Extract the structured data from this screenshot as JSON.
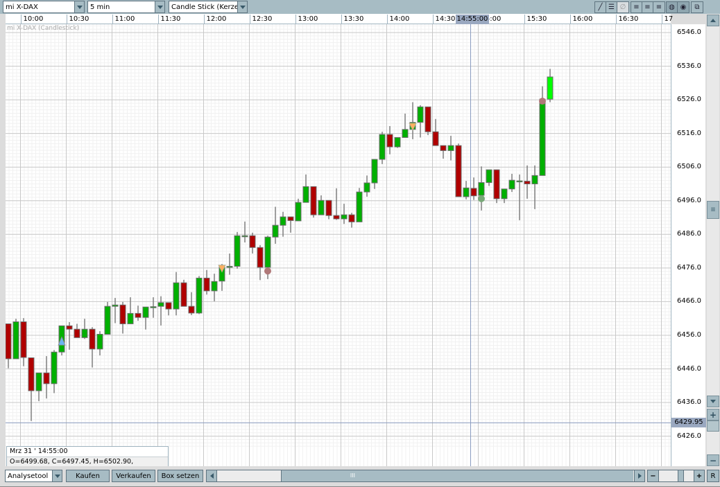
{
  "toolbar": {
    "instrument": "mi X-DAX",
    "interval": "5 min",
    "chart_type": "Candle Stick (Kerze",
    "icons": [
      "line-draw-icon",
      "horizontal-lines-icon",
      "delete-drawing-icon",
      "grid-lines-icon",
      "grid-dashed-icon",
      "grid-dotted-icon",
      "color-scheme-icon",
      "pattern-icon",
      "detach-window-icon"
    ]
  },
  "chart_title": "mi X-DAX (Candlestick)",
  "time_axis": {
    "labels": [
      "10:00",
      "10:30",
      "11:00",
      "11:30",
      "12:00",
      "12:30",
      "13:00",
      "13:30",
      "14:00",
      "14:30",
      "15:00",
      "15:30",
      "16:00",
      "16:30",
      "17"
    ],
    "cursor_label": "14:55:00"
  },
  "price_axis": {
    "labels": [
      "6546.0",
      "6536.0",
      "6526.0",
      "6516.0",
      "6506.0",
      "6496.0",
      "6486.0",
      "6476.0",
      "6466.0",
      "6456.0",
      "6446.0",
      "6436.0",
      "6426.0"
    ],
    "cursor_label": "6429.95"
  },
  "info": {
    "date": "Mrz 31 ' 14:55:00",
    "ohlc": "O=6499.68, C=6497.45, H=6502.90, L=6496.22"
  },
  "bottom": {
    "tool_select": "Analysetool",
    "buy": "Kaufen",
    "sell": "Verkaufen",
    "box": "Box setzen",
    "reset": "R",
    "scroll_grip": "III"
  },
  "colors": {
    "up": "#00b000",
    "down": "#b00000",
    "last_up": "#00ff00",
    "outline": "#6e6e6e",
    "crosshair": "#8a9cc0",
    "toolbar": "#a7bcc4"
  },
  "chart_data": {
    "type": "candlestick",
    "interval": "5 min",
    "ylim": [
      6423,
      6550
    ],
    "xlim": [
      "09:45",
      "17:05"
    ],
    "grid": true,
    "crosshair": {
      "time": "14:55",
      "price": 6429.95
    },
    "candles": [
      {
        "t": "09:50",
        "o": 6459.4,
        "h": 6459.4,
        "l": 6446.2,
        "c": 6449.0
      },
      {
        "t": "09:55",
        "o": 6449.0,
        "h": 6460.9,
        "l": 6449.0,
        "c": 6460.0
      },
      {
        "t": "10:00",
        "o": 6460.0,
        "h": 6461.1,
        "l": 6446.8,
        "c": 6449.4
      },
      {
        "t": "10:05",
        "o": 6449.3,
        "h": 6449.3,
        "l": 6430.5,
        "c": 6439.5
      },
      {
        "t": "10:10",
        "o": 6439.5,
        "h": 6444.8,
        "l": 6436.4,
        "c": 6444.8
      },
      {
        "t": "10:15",
        "o": 6444.8,
        "h": 6449.8,
        "l": 6437.2,
        "c": 6441.6
      },
      {
        "t": "10:20",
        "o": 6441.6,
        "h": 6451.6,
        "l": 6438.8,
        "c": 6451.0
      },
      {
        "t": "10:25",
        "o": 6451.0,
        "h": 6458.8,
        "l": 6450.0,
        "c": 6458.8
      },
      {
        "t": "10:30",
        "o": 6458.8,
        "h": 6459.9,
        "l": 6451.7,
        "c": 6457.8
      },
      {
        "t": "10:35",
        "o": 6457.8,
        "h": 6459.4,
        "l": 6455.3,
        "c": 6455.3
      },
      {
        "t": "10:40",
        "o": 6455.3,
        "h": 6460.9,
        "l": 6454.9,
        "c": 6457.8
      },
      {
        "t": "10:45",
        "o": 6457.8,
        "h": 6458.4,
        "l": 6446.4,
        "c": 6451.9
      },
      {
        "t": "10:50",
        "o": 6451.9,
        "h": 6457.2,
        "l": 6450.0,
        "c": 6456.3
      },
      {
        "t": "10:55",
        "o": 6456.3,
        "h": 6465.9,
        "l": 6456.3,
        "c": 6464.6
      },
      {
        "t": "11:00",
        "o": 6464.6,
        "h": 6467.1,
        "l": 6459.6,
        "c": 6465.0
      },
      {
        "t": "11:05",
        "o": 6465.0,
        "h": 6465.9,
        "l": 6456.5,
        "c": 6459.4
      },
      {
        "t": "11:10",
        "o": 6459.4,
        "h": 6467.3,
        "l": 6459.4,
        "c": 6462.5
      },
      {
        "t": "11:15",
        "o": 6462.5,
        "h": 6464.8,
        "l": 6460.3,
        "c": 6461.3
      },
      {
        "t": "11:20",
        "o": 6461.3,
        "h": 6464.4,
        "l": 6457.7,
        "c": 6464.4
      },
      {
        "t": "11:25",
        "o": 6464.5,
        "h": 6467.3,
        "l": 6461.2,
        "c": 6464.5
      },
      {
        "t": "11:30",
        "o": 6464.6,
        "h": 6467.6,
        "l": 6458.9,
        "c": 6465.7
      },
      {
        "t": "11:35",
        "o": 6465.7,
        "h": 6465.7,
        "l": 6461.9,
        "c": 6463.8
      },
      {
        "t": "11:40",
        "o": 6463.8,
        "h": 6474.8,
        "l": 6461.9,
        "c": 6471.6
      },
      {
        "t": "11:45",
        "o": 6471.6,
        "h": 6472.5,
        "l": 6464.6,
        "c": 6464.6
      },
      {
        "t": "11:50",
        "o": 6464.6,
        "h": 6468.8,
        "l": 6462.0,
        "c": 6462.6
      },
      {
        "t": "11:55",
        "o": 6462.6,
        "h": 6473.6,
        "l": 6462.3,
        "c": 6473.0
      },
      {
        "t": "12:00",
        "o": 6473.0,
        "h": 6475.4,
        "l": 6468.1,
        "c": 6469.2
      },
      {
        "t": "12:05",
        "o": 6469.2,
        "h": 6474.3,
        "l": 6466.1,
        "c": 6472.0
      },
      {
        "t": "12:10",
        "o": 6472.1,
        "h": 6477.2,
        "l": 6469.2,
        "c": 6476.5
      },
      {
        "t": "12:15",
        "o": 6476.5,
        "h": 6480.3,
        "l": 6474.0,
        "c": 6476.5
      },
      {
        "t": "12:20",
        "o": 6476.5,
        "h": 6486.7,
        "l": 6475.8,
        "c": 6485.6
      },
      {
        "t": "12:25",
        "o": 6485.6,
        "h": 6489.8,
        "l": 6483.6,
        "c": 6485.6
      },
      {
        "t": "12:30",
        "o": 6485.6,
        "h": 6486.5,
        "l": 6480.3,
        "c": 6482.1
      },
      {
        "t": "12:35",
        "o": 6482.1,
        "h": 6482.8,
        "l": 6472.4,
        "c": 6476.2
      },
      {
        "t": "12:40",
        "o": 6476.2,
        "h": 6485.6,
        "l": 6472.7,
        "c": 6485.2
      },
      {
        "t": "12:45",
        "o": 6485.2,
        "h": 6494.2,
        "l": 6483.2,
        "c": 6488.7
      },
      {
        "t": "12:50",
        "o": 6488.7,
        "h": 6492.7,
        "l": 6485.3,
        "c": 6491.2
      },
      {
        "t": "12:55",
        "o": 6491.2,
        "h": 6491.2,
        "l": 6486.5,
        "c": 6490.1
      },
      {
        "t": "13:00",
        "o": 6490.0,
        "h": 6496.6,
        "l": 6490.0,
        "c": 6495.5
      },
      {
        "t": "13:05",
        "o": 6495.5,
        "h": 6503.8,
        "l": 6495.5,
        "c": 6500.2
      },
      {
        "t": "13:10",
        "o": 6500.2,
        "h": 6500.2,
        "l": 6491.0,
        "c": 6491.8
      },
      {
        "t": "13:15",
        "o": 6491.8,
        "h": 6497.6,
        "l": 6491.8,
        "c": 6496.1
      },
      {
        "t": "13:20",
        "o": 6496.1,
        "h": 6496.1,
        "l": 6490.5,
        "c": 6491.6
      },
      {
        "t": "13:25",
        "o": 6491.6,
        "h": 6499.7,
        "l": 6490.3,
        "c": 6490.6
      },
      {
        "t": "13:30",
        "o": 6490.6,
        "h": 6495.1,
        "l": 6489.1,
        "c": 6491.8
      },
      {
        "t": "13:35",
        "o": 6491.8,
        "h": 6492.4,
        "l": 6488.0,
        "c": 6489.7
      },
      {
        "t": "13:40",
        "o": 6489.7,
        "h": 6499.8,
        "l": 6489.7,
        "c": 6498.6
      },
      {
        "t": "13:45",
        "o": 6498.6,
        "h": 6503.5,
        "l": 6497.2,
        "c": 6501.3
      },
      {
        "t": "13:50",
        "o": 6501.3,
        "h": 6508.3,
        "l": 6499.5,
        "c": 6508.3
      },
      {
        "t": "13:55",
        "o": 6508.3,
        "h": 6516.5,
        "l": 6506.9,
        "c": 6515.7
      },
      {
        "t": "14:00",
        "o": 6515.7,
        "h": 6518.2,
        "l": 6509.8,
        "c": 6512.0
      },
      {
        "t": "14:05",
        "o": 6512.0,
        "h": 6514.8,
        "l": 6511.7,
        "c": 6514.8
      },
      {
        "t": "14:10",
        "o": 6514.8,
        "h": 6521.9,
        "l": 6514.8,
        "c": 6517.2
      },
      {
        "t": "14:15",
        "o": 6517.2,
        "h": 6525.3,
        "l": 6514.3,
        "c": 6519.3
      },
      {
        "t": "14:20",
        "o": 6519.3,
        "h": 6524.4,
        "l": 6514.8,
        "c": 6523.9
      },
      {
        "t": "14:25",
        "o": 6523.9,
        "h": 6523.9,
        "l": 6515.5,
        "c": 6516.5
      },
      {
        "t": "14:30",
        "o": 6516.5,
        "h": 6520.3,
        "l": 6512.4,
        "c": 6512.4
      },
      {
        "t": "14:35",
        "o": 6512.4,
        "h": 6512.4,
        "l": 6508.5,
        "c": 6510.9
      },
      {
        "t": "14:40",
        "o": 6510.9,
        "h": 6515.3,
        "l": 6508.0,
        "c": 6512.4
      },
      {
        "t": "14:45",
        "o": 6512.4,
        "h": 6513.0,
        "l": 6497.2,
        "c": 6497.2
      },
      {
        "t": "14:50",
        "o": 6497.2,
        "h": 6501.9,
        "l": 6496.4,
        "c": 6499.8
      },
      {
        "t": "14:55",
        "o": 6499.68,
        "h": 6502.9,
        "l": 6496.22,
        "c": 6497.45
      },
      {
        "t": "15:00",
        "o": 6497.6,
        "h": 6506.2,
        "l": 6493.1,
        "c": 6501.4
      },
      {
        "t": "15:05",
        "o": 6501.4,
        "h": 6505.2,
        "l": 6500.4,
        "c": 6505.2
      },
      {
        "t": "15:10",
        "o": 6505.2,
        "h": 6505.2,
        "l": 6495.3,
        "c": 6496.6
      },
      {
        "t": "15:15",
        "o": 6496.6,
        "h": 6499.5,
        "l": 6495.3,
        "c": 6499.5
      },
      {
        "t": "15:20",
        "o": 6499.5,
        "h": 6504.0,
        "l": 6498.6,
        "c": 6502.1
      },
      {
        "t": "15:25",
        "o": 6501.9,
        "h": 6503.8,
        "l": 6490.2,
        "c": 6501.9
      },
      {
        "t": "15:30",
        "o": 6501.8,
        "h": 6506.5,
        "l": 6496.6,
        "c": 6501.0
      },
      {
        "t": "15:35",
        "o": 6501.0,
        "h": 6506.5,
        "l": 6493.5,
        "c": 6503.5
      },
      {
        "t": "15:40",
        "o": 6503.5,
        "h": 6530.0,
        "l": 6503.5,
        "c": 6526.2
      },
      {
        "t": "15:45",
        "o": 6526.2,
        "h": 6535.2,
        "l": 6525.3,
        "c": 6532.8
      }
    ],
    "markers": [
      {
        "t": "10:25",
        "price": 6454.1,
        "shape": "triangle-up",
        "color": "#6ab4f0"
      },
      {
        "t": "12:10",
        "price": 6475.8,
        "shape": "triangle-down",
        "color": "#ffb060"
      },
      {
        "t": "12:40",
        "price": 6475.1,
        "shape": "circle",
        "color": "#b07878"
      },
      {
        "t": "14:15",
        "price": 6518.0,
        "shape": "triangle-down",
        "color": "#ffb060"
      },
      {
        "t": "15:00",
        "price": 6496.6,
        "shape": "circle",
        "color": "#78a878"
      },
      {
        "t": "15:40",
        "price": 6525.6,
        "shape": "circle",
        "color": "#b07878"
      }
    ]
  }
}
